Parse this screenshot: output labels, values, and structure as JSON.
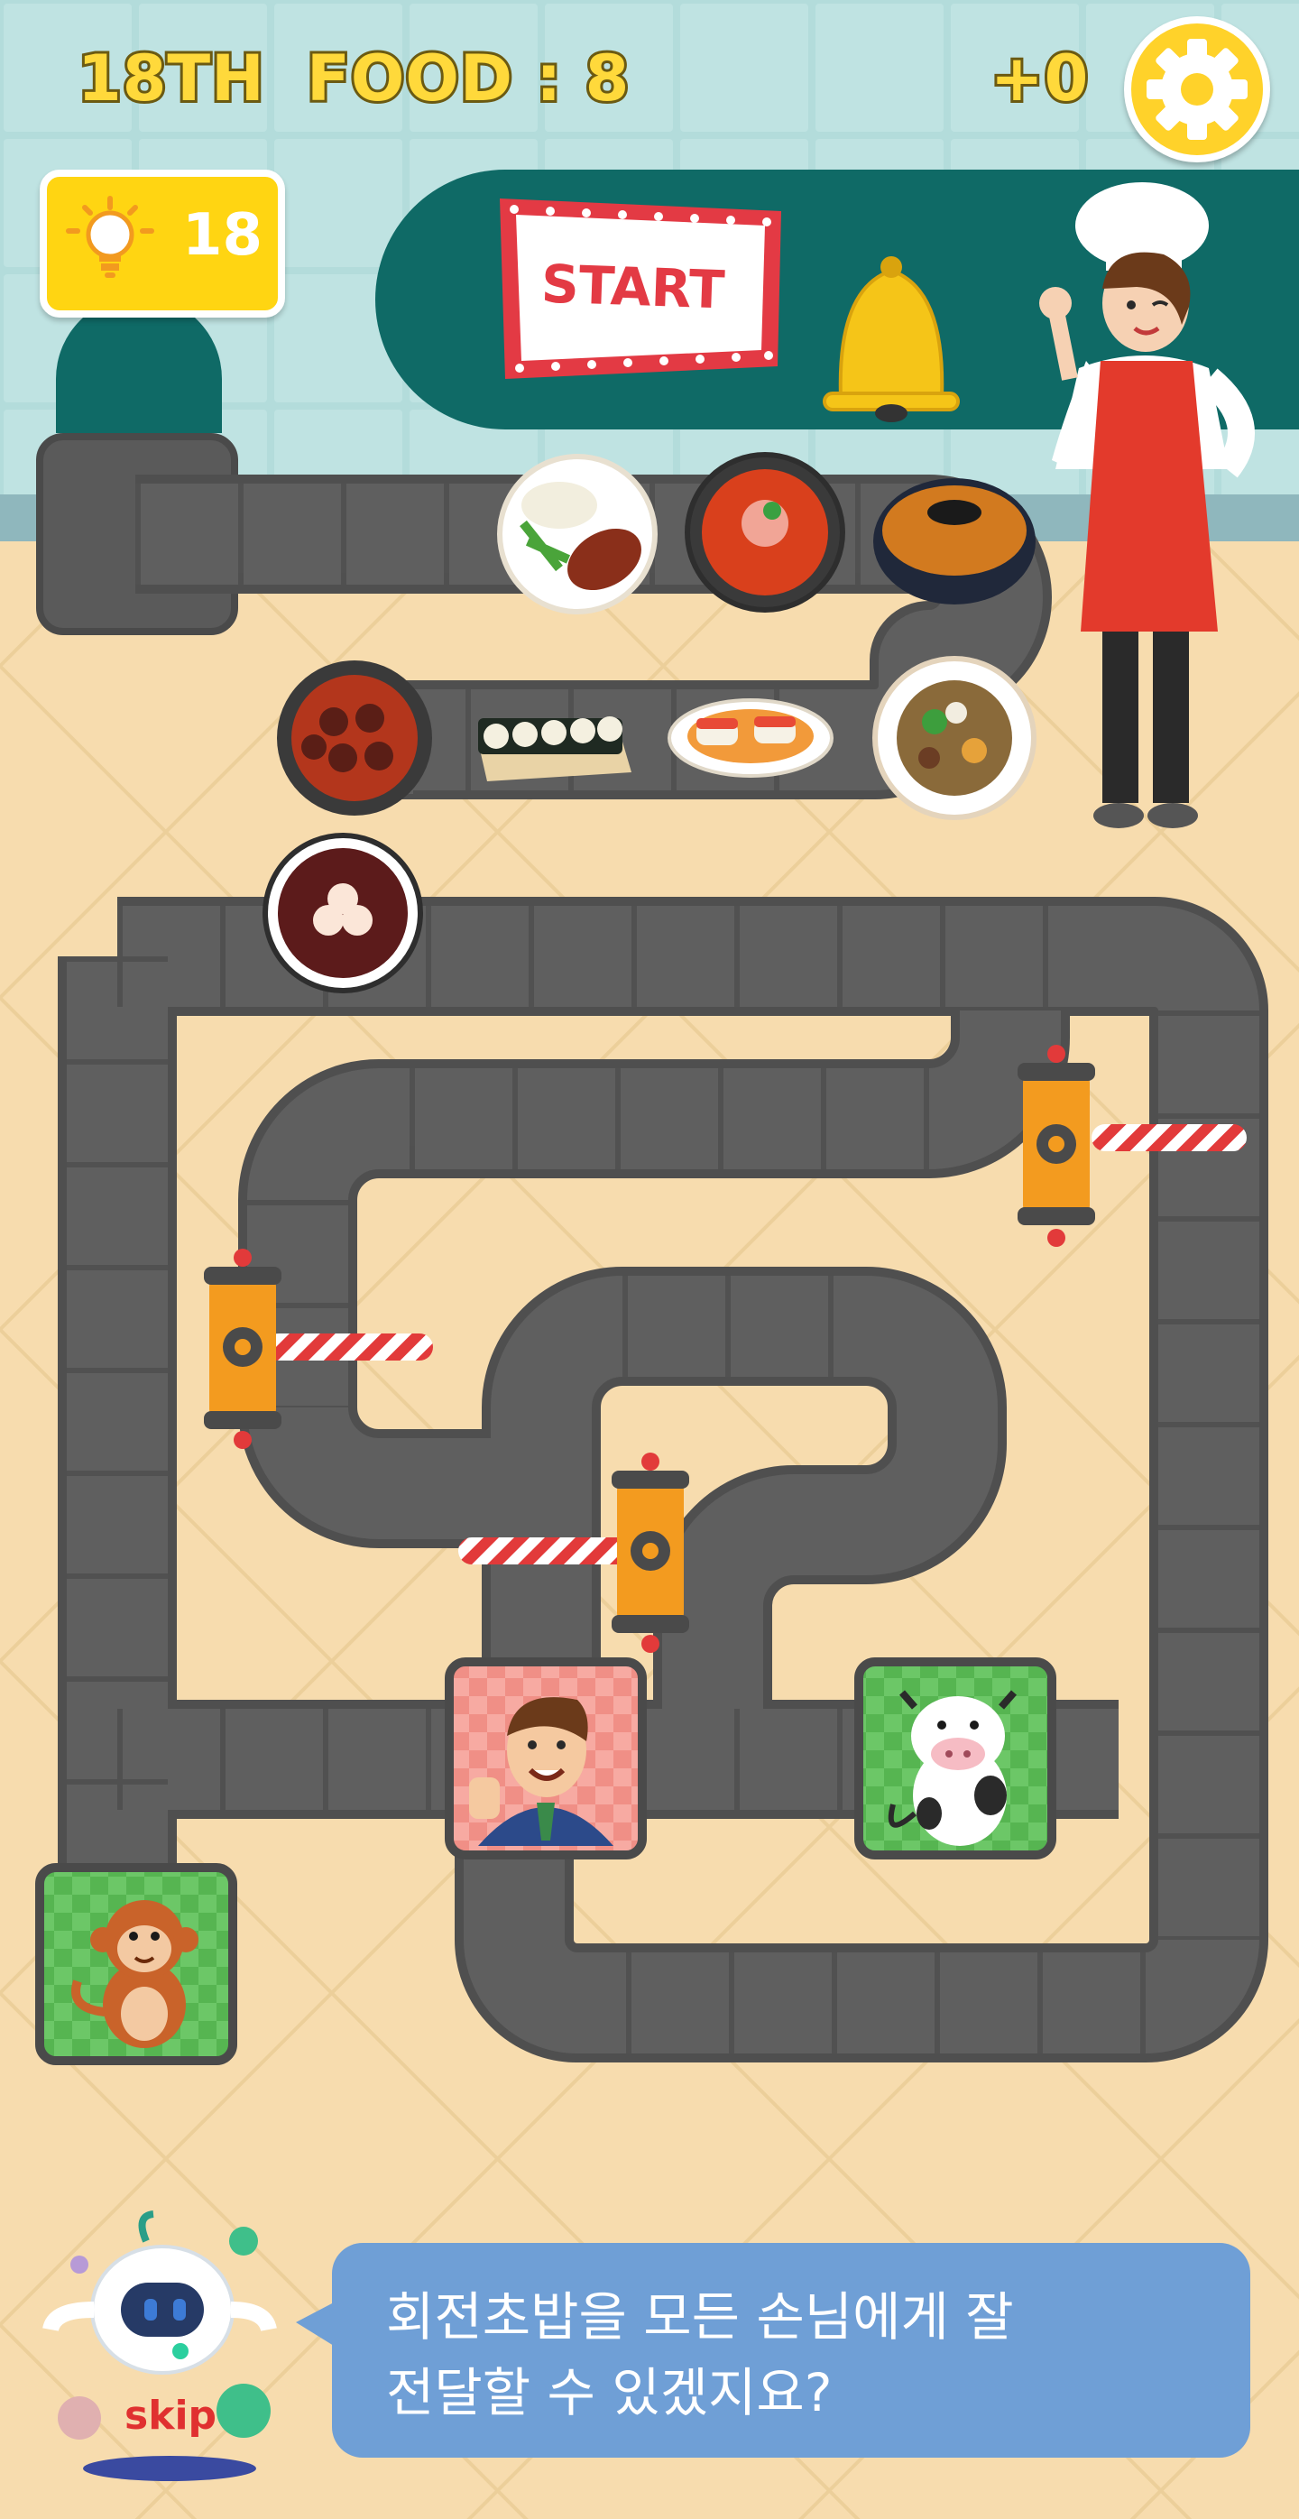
{
  "hud": {
    "level": "18TH",
    "food_label": "FOOD : 8",
    "bonus": "+0",
    "hints": "18"
  },
  "sign": {
    "start": "START"
  },
  "tutorial": {
    "line1": "회전초밥을 모든 손님에게 잘",
    "line2": "전달할 수 있겠지요?",
    "skip": "skip"
  },
  "icons": {
    "settings": "gear-icon",
    "hint": "lightbulb-icon",
    "bell": "bell-icon"
  },
  "food_items": [
    "steak-plate",
    "spicy-noodles",
    "ramen-bowl",
    "braised-meat",
    "kimbap",
    "sushi",
    "japchae",
    "red-bean-porridge"
  ],
  "customers": [
    "businessman",
    "cow",
    "monkey"
  ],
  "levers": [
    "lever-right",
    "lever-left",
    "lever-center"
  ],
  "colors": {
    "belt": "#585858",
    "wall": "#b6dedd",
    "floor": "#f7ddb0",
    "counter": "#0f6a66",
    "bubble": "#6f9fd6",
    "hud_yellow": "#ffd93b"
  }
}
